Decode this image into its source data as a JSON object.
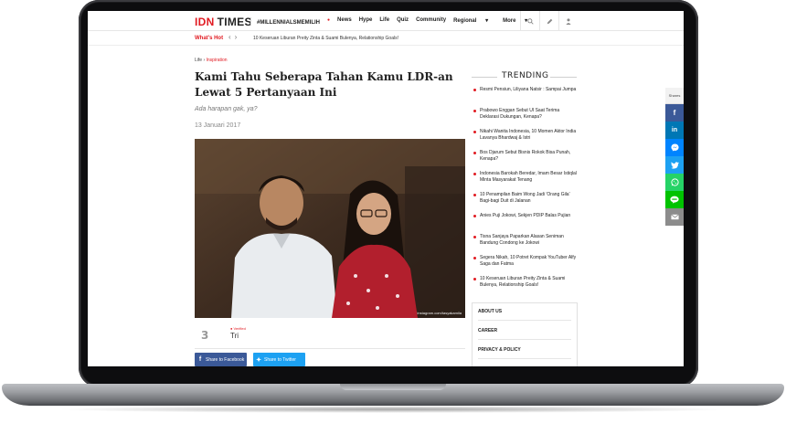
{
  "header": {
    "logo_idn": "IDN",
    "logo_times": "TIMES",
    "nav": [
      "#MILLENNIALSMEMILIH",
      "News",
      "Hype",
      "Life",
      "Quiz",
      "Community",
      "Regional",
      "More"
    ],
    "nav_regional_suffix": "▾",
    "nav_more_suffix": "▾",
    "icons": [
      "search-icon",
      "pencil-icon",
      "user-icon"
    ]
  },
  "hot": {
    "label": "What's Hot",
    "headline": "10 Keseruan Liburan Preity Zinta & Suami Bulenya, Relationship Goals!"
  },
  "article": {
    "breadcrumb_section": "Life",
    "breadcrumb_sep": "›",
    "breadcrumb_category": "Inspiration",
    "title": "Kami Tahu Seberapa Tahan Kamu LDR-an Lewat 5 Pertanyaan Ini",
    "subtitle": "Ada harapan gak, ya?",
    "date": "13 Januari 2017",
    "photo_credit": "instagram.com/tasyakamila",
    "author_badge": "● Verified",
    "author_name": "Tri",
    "share_facebook": "Share to Facebook",
    "share_twitter": "Share to Twitter"
  },
  "trending": {
    "heading": "TRENDING",
    "items": [
      "Resmi Pensiun, Liliyana Natsir : Sampai Jumpa",
      "Prabowo Enggan Sebut UI Saat Terima Deklarasi Dukungan, Kenapa?",
      "Nikahi Wanita Indonesia, 10 Momen Aktor India Lavanya Bhardwaj & Istri",
      "Bos Djarum Sebut Bisnis Rokok Bisa Punah, Kenapa?",
      "Indonesia Barokah Beredar, Imam Besar Istiqlal Minta Masyarakat Tenang",
      "10 Penampilan Baim Wong Jadi 'Orang Gila' Bagi-bagi Duit di Jalanan",
      "Anies Puji Jokowi, Sekjen PDIP Balas Pujian",
      "Tisna Sanjaya Paparkan Alasan Seniman Bandung Condong ke Jokowi",
      "Segera Nikah, 10 Potret Kompak YouTuber Alfy Saga dan Fatma",
      "10 Keseruan Liburan Preity Zinta & Suami Bulenya, Relationship Goals!"
    ]
  },
  "footer_links": [
    "ABOUT US",
    "CAREER",
    "PRIVACY & POLICY"
  ],
  "share_rail": {
    "label": "Shares",
    "buttons": [
      {
        "name": "facebook-icon",
        "glyph": "f",
        "color": "#3b5998"
      },
      {
        "name": "linkedin-icon",
        "glyph": "in",
        "color": "#0077b5"
      },
      {
        "name": "messenger-icon",
        "glyph": "➤",
        "color": "#0084ff"
      },
      {
        "name": "twitter-icon",
        "glyph": "✦",
        "color": "#1da1f2"
      },
      {
        "name": "whatsapp-icon",
        "glyph": "✆",
        "color": "#25d366"
      },
      {
        "name": "line-icon",
        "glyph": "▬",
        "color": "#00c300"
      },
      {
        "name": "email-icon",
        "glyph": "✉",
        "color": "#8c8c8c"
      }
    ]
  },
  "colors": {
    "brand_red": "#e11b22",
    "facebook": "#3b5998",
    "twitter": "#1da1f2"
  }
}
